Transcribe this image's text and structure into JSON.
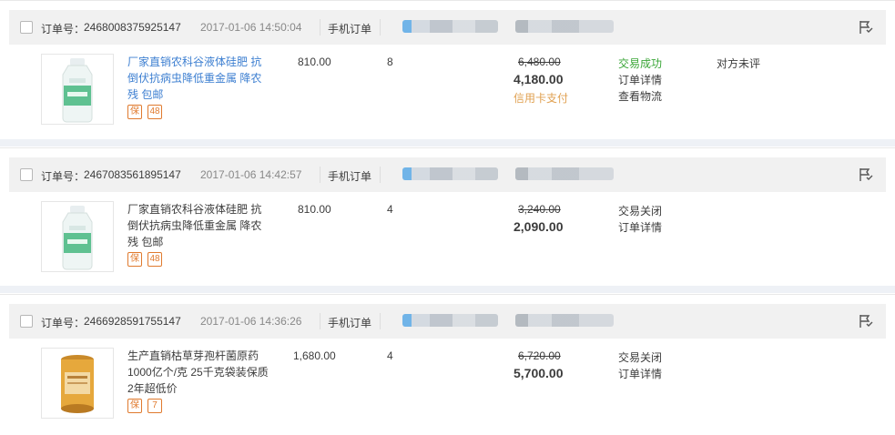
{
  "orders": [
    {
      "order_label": "订单号：",
      "order_no": "2468008375925147",
      "time": "2017-01-06 14:50:04",
      "source": "手机订单",
      "title": "厂家直销农科谷液体硅肥 抗倒伏抗病虫降低重金属 降农残 包邮",
      "unit_price": "810.00",
      "qty": "8",
      "orig_total": "6,480.00",
      "total": "4,180.00",
      "payment": "信用卡支付",
      "status": "交易成功",
      "detail_link": "订单详情",
      "logistics_link": "查看物流",
      "review": "对方未评",
      "badges": [
        "保",
        "48"
      ]
    },
    {
      "order_label": "订单号：",
      "order_no": "2467083561895147",
      "time": "2017-01-06 14:42:57",
      "source": "手机订单",
      "title": "厂家直销农科谷液体硅肥 抗倒伏抗病虫降低重金属 降农残 包邮",
      "unit_price": "810.00",
      "qty": "4",
      "orig_total": "3,240.00",
      "total": "2,090.00",
      "status": "交易关闭",
      "detail_link": "订单详情",
      "badges": [
        "保",
        "48"
      ]
    },
    {
      "order_label": "订单号：",
      "order_no": "2466928591755147",
      "time": "2017-01-06 14:36:26",
      "source": "手机订单",
      "title": "生产直销枯草芽孢杆菌原药1000亿个/克 25千克袋装保质2年超低价",
      "unit_price": "1,680.00",
      "qty": "4",
      "orig_total": "6,720.00",
      "total": "5,700.00",
      "status": "交易关闭",
      "detail_link": "订单详情",
      "badges": [
        "保",
        "7"
      ]
    }
  ],
  "colors": {
    "link": "#3d7fd1",
    "success": "#3aa637",
    "payment": "#e0a050",
    "badge": "#e07a2e"
  },
  "icons": [
    "checkbox-icon",
    "flag-icon",
    "bottle-product-icon",
    "canister-product-icon",
    "guarantee-badge-icon"
  ]
}
